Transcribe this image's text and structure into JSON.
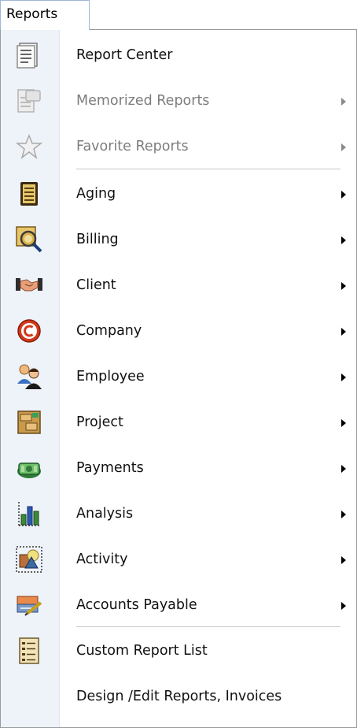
{
  "menubar": {
    "title": "Reports"
  },
  "menu": {
    "items": [
      {
        "label": "Report Center",
        "icon": "report-center-icon",
        "enabled": true,
        "submenu": false
      },
      {
        "label": "Memorized Reports",
        "icon": "memorized-reports-icon",
        "enabled": false,
        "submenu": true
      },
      {
        "label": "Favorite Reports",
        "icon": "star-icon",
        "enabled": false,
        "submenu": true
      },
      {
        "label": "Aging",
        "icon": "ledger-icon",
        "enabled": true,
        "submenu": true
      },
      {
        "label": "Billing",
        "icon": "billing-magnifier-icon",
        "enabled": true,
        "submenu": true
      },
      {
        "label": "Client",
        "icon": "handshake-icon",
        "enabled": true,
        "submenu": true
      },
      {
        "label": "Company",
        "icon": "company-c-icon",
        "enabled": true,
        "submenu": true
      },
      {
        "label": "Employee",
        "icon": "employee-people-icon",
        "enabled": true,
        "submenu": true
      },
      {
        "label": "Project",
        "icon": "project-cabinet-icon",
        "enabled": true,
        "submenu": true
      },
      {
        "label": "Payments",
        "icon": "money-icon",
        "enabled": true,
        "submenu": true
      },
      {
        "label": "Analysis",
        "icon": "bar-chart-icon",
        "enabled": true,
        "submenu": true
      },
      {
        "label": "Activity",
        "icon": "activity-icon",
        "enabled": true,
        "submenu": true
      },
      {
        "label": "Accounts Payable",
        "icon": "payable-pen-icon",
        "enabled": true,
        "submenu": true
      },
      {
        "label": "Custom Report List",
        "icon": "custom-list-icon",
        "enabled": true,
        "submenu": false
      },
      {
        "label": "Design /Edit Reports, Invoices",
        "icon": "",
        "enabled": true,
        "submenu": false
      }
    ]
  },
  "colors": {
    "icon_column": "#eef3fa",
    "disabled_text": "#7d7d7d",
    "menu_border": "#9a9a9a"
  }
}
